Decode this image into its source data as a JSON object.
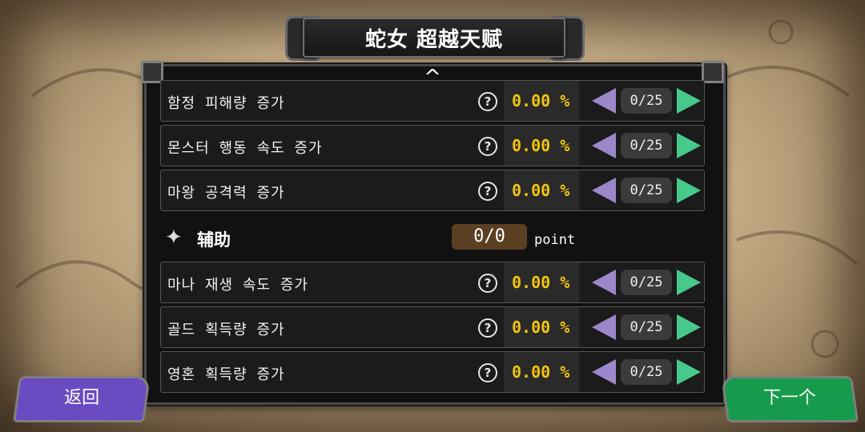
{
  "title": "蛇女 超越天赋",
  "rows_top": [
    {
      "label": "함정 피해량 증가",
      "value": "0.00 %",
      "level": "0/25"
    },
    {
      "label": "몬스터 행동 속도 증가",
      "value": "0.00 %",
      "level": "0/25"
    },
    {
      "label": "마왕 공격력 증가",
      "value": "0.00 %",
      "level": "0/25"
    }
  ],
  "section": {
    "title": "辅助",
    "points": "0/0",
    "unit": "point"
  },
  "rows_bottom": [
    {
      "label": "마나 재생 속도 증가",
      "value": "0.00 %",
      "level": "0/25"
    },
    {
      "label": "골드 획득량 증가",
      "value": "0.00 %",
      "level": "0/25"
    },
    {
      "label": "영혼 획득량 증가",
      "value": "0.00 %",
      "level": "0/25"
    }
  ],
  "help_glyph": "?",
  "scroll_up_glyph": "^",
  "section_icon_glyph": "✦",
  "buttons": {
    "back": "返回",
    "next": "下一个"
  },
  "colors": {
    "value": "#f1c40f",
    "decrease_arrow": "#9b87c9",
    "increase_arrow": "#48c98c",
    "back_button": "#6b4bc2",
    "next_button": "#159b4b"
  }
}
